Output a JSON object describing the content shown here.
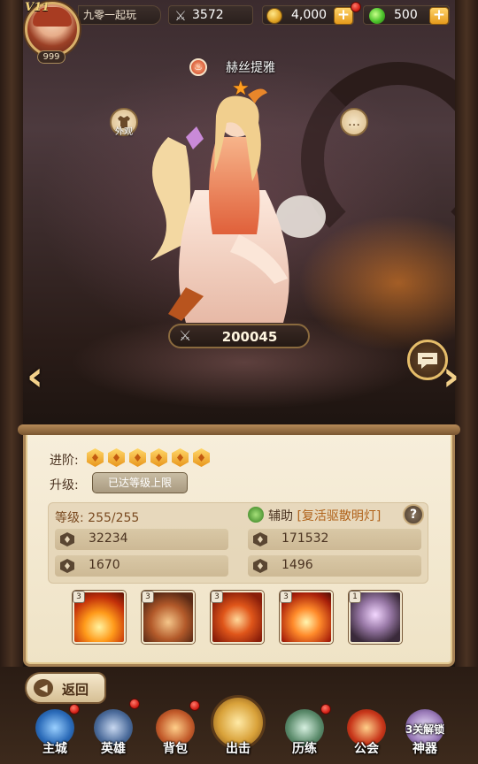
{
  "player": {
    "vip": "V11",
    "level": "999",
    "name": "九零一起玩"
  },
  "resources": {
    "power": "3572",
    "gold": "4,000",
    "gems": "500",
    "plus": "+"
  },
  "hero": {
    "name": "赫丝提雅",
    "stars": "★",
    "element_glyph": "♨",
    "skin_label": "外观",
    "chat_glyph": "…",
    "combat_power": "200045"
  },
  "panel": {
    "advance_label": "进阶:",
    "upgrade_label": "升级:",
    "max_level_tag": "已达等级上限",
    "level_label": "等级:",
    "level_value": "255/255",
    "role": "辅助",
    "role_skill": "[复活驱散明灯]",
    "help": "?",
    "stats": {
      "hp": "32234",
      "attack": "171532",
      "defense": "1670",
      "speed": "1496"
    },
    "skills": [
      {
        "level": "3"
      },
      {
        "level": "3"
      },
      {
        "level": "3"
      },
      {
        "level": "3"
      },
      {
        "level": "1"
      }
    ]
  },
  "nav": {
    "back": "返回",
    "items": [
      "主城",
      "英雄",
      "背包",
      "出击",
      "历练",
      "公会",
      "神器"
    ],
    "unlock_tag": "3关解锁"
  }
}
